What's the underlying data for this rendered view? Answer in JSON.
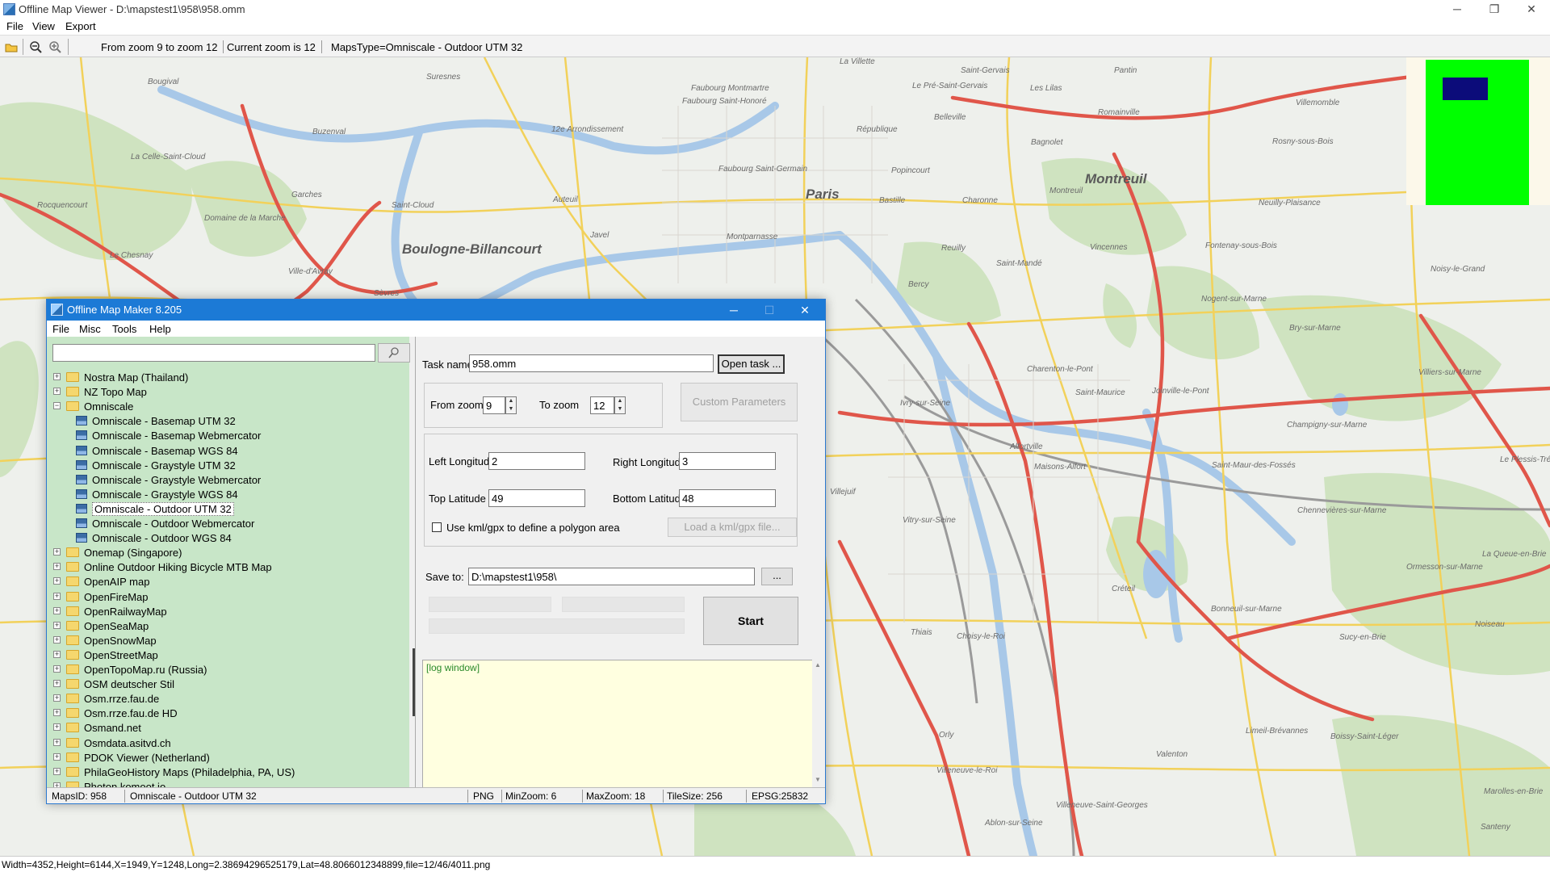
{
  "viewer": {
    "title": "Offline Map Viewer - D:\\mapstest1\\958\\958.omm",
    "menu": [
      "File",
      "View",
      "Export"
    ],
    "toolbar": {
      "zoom_range": "From zoom 9 to zoom 12",
      "current_zoom": "Current zoom is 12",
      "maps_type": "MapsType=Omniscale - Outdoor UTM 32"
    },
    "status": "Width=4352,Height=6144,X=1949,Y=1248,Long=2.38694296525179,Lat=48.8066012348899,file=12/46/4011.png"
  },
  "map": {
    "labels": [
      "Suresnes",
      "Bougival",
      "Buzenval",
      "La Celle-Saint-Cloud",
      "Garches",
      "Rocquencourt",
      "Saint-Cloud",
      "Domaine de la Marche",
      "Le Chesnay",
      "Ville-d'Avray",
      "Sèvres",
      "Boulogne-Billancourt",
      "Paris",
      "Montreuil",
      "Faubourg Montmartre",
      "Belleville",
      "République",
      "Popincourt",
      "Charonne",
      "Bastille",
      "Bagnolet",
      "Les Lilas",
      "Romainville",
      "Villemomble",
      "Rosny-sous-Bois",
      "Vincennes",
      "Saint-Mandé",
      "Fontenay-sous-Bois",
      "Neuilly-Plaisance",
      "Nogent-sur-Marne",
      "Bry-sur-Marne",
      "Noisy-le-Grand",
      "Ivry-sur-Seine",
      "Charenton-le-Pont",
      "Saint-Maurice",
      "Joinville-le-Pont",
      "Maisons-Alfort",
      "Villejuif",
      "Vitry-sur-Seine",
      "Créteil",
      "Champigny-sur-Marne",
      "Chennevières-sur-Marne",
      "Saint-Maur-des-Fossés",
      "Bonneuil-sur-Marne",
      "Thiais",
      "Choisy-le-Roi",
      "Orly",
      "Villeneuve-le-Roi",
      "Valenton",
      "Limeil-Brévannes",
      "Boissy-Saint-Léger",
      "Villeneuve-Saint-Georges",
      "Ablon-sur-Seine",
      "Sucy-en-Brie",
      "Ormesson-sur-Marne",
      "Le Plessis-Trévise",
      "La Queue-en-Brie",
      "Noiseau",
      "Marolles-en-Brie",
      "Santeny",
      "Villiers-sur-Marne",
      "Auteuil",
      "Javel",
      "Montparnasse",
      "Reuilly",
      "Bercy",
      "Alfortville",
      "Faubourg Saint-Honoré",
      "Faubourg Saint-Germain",
      "12e Arrondissement",
      "Saint-Gervais",
      "La Villette",
      "Montreuil",
      "Le Pré-Saint-Gervais",
      "Pantin"
    ]
  },
  "dialog": {
    "title": "Offline Map Maker 8.205",
    "menu": [
      "File",
      "Misc",
      "Tools",
      "Help"
    ],
    "search_value": "",
    "tree": [
      {
        "label": "Nostra Map (Thailand)",
        "level": 0,
        "expand": "+"
      },
      {
        "label": "NZ Topo Map",
        "level": 0,
        "expand": "+"
      },
      {
        "label": "Omniscale",
        "level": 0,
        "expand": "-"
      },
      {
        "label": "Omniscale - Basemap UTM 32",
        "level": 1
      },
      {
        "label": "Omniscale - Basemap Webmercator",
        "level": 1
      },
      {
        "label": "Omniscale - Basemap WGS 84",
        "level": 1
      },
      {
        "label": "Omniscale - Graystyle UTM 32",
        "level": 1
      },
      {
        "label": "Omniscale - Graystyle Webmercator",
        "level": 1
      },
      {
        "label": "Omniscale - Graystyle WGS 84",
        "level": 1
      },
      {
        "label": "Omniscale - Outdoor UTM 32",
        "level": 1,
        "selected": true
      },
      {
        "label": "Omniscale - Outdoor Webmercator",
        "level": 1
      },
      {
        "label": "Omniscale - Outdoor WGS 84",
        "level": 1
      },
      {
        "label": "Onemap (Singapore)",
        "level": 0,
        "expand": "+"
      },
      {
        "label": "Online Outdoor Hiking Bicycle MTB Map",
        "level": 0,
        "expand": "+"
      },
      {
        "label": "OpenAIP map",
        "level": 0,
        "expand": "+"
      },
      {
        "label": "OpenFireMap",
        "level": 0,
        "expand": "+"
      },
      {
        "label": "OpenRailwayMap",
        "level": 0,
        "expand": "+"
      },
      {
        "label": "OpenSeaMap",
        "level": 0,
        "expand": "+"
      },
      {
        "label": "OpenSnowMap",
        "level": 0,
        "expand": "+"
      },
      {
        "label": "OpenStreetMap",
        "level": 0,
        "expand": "+"
      },
      {
        "label": "OpenTopoMap.ru (Russia)",
        "level": 0,
        "expand": "+"
      },
      {
        "label": "OSM deutscher Stil",
        "level": 0,
        "expand": "+"
      },
      {
        "label": "Osm.rrze.fau.de",
        "level": 0,
        "expand": "+"
      },
      {
        "label": "Osm.rrze.fau.de HD",
        "level": 0,
        "expand": "+"
      },
      {
        "label": "Osmand.net",
        "level": 0,
        "expand": "+"
      },
      {
        "label": "Osmdata.asitvd.ch",
        "level": 0,
        "expand": "+"
      },
      {
        "label": "PDOK Viewer (Netherland)",
        "level": 0,
        "expand": "+"
      },
      {
        "label": "PhilaGeoHistory Maps (Philadelphia, PA, US)",
        "level": 0,
        "expand": "+"
      },
      {
        "label": "Photon.komoot.io",
        "level": 0,
        "expand": "+"
      }
    ],
    "form": {
      "task_name_label": "Task name",
      "task_name_value": "958.omm",
      "open_task_label": "Open task ...",
      "from_zoom_label": "From zoom",
      "from_zoom_value": "9",
      "to_zoom_label": "To zoom",
      "to_zoom_value": "12",
      "custom_params_label": "Custom Parameters",
      "left_lon_label": "Left Longitude",
      "left_lon_value": "2",
      "right_lon_label": "Right Longitude",
      "right_lon_value": "3",
      "top_lat_label": "Top Latitude",
      "top_lat_value": "49",
      "bottom_lat_label": "Bottom Latitude",
      "bottom_lat_value": "48",
      "kml_label": "Use kml/gpx to define a polygon area",
      "load_kml_label": "Load a kml/gpx file...",
      "save_to_label": "Save to:",
      "save_to_value": "D:\\mapstest1\\958\\",
      "browse_label": "...",
      "start_label": "Start"
    },
    "log_text": "[log window]",
    "status": {
      "maps_id": "MapsID: 958",
      "maps_name": "Omniscale - Outdoor UTM 32",
      "format": "PNG",
      "min_zoom": "MinZoom: 6",
      "max_zoom": "MaxZoom: 18",
      "tile_size": "TileSize: 256",
      "epsg": "EPSG:25832"
    }
  }
}
